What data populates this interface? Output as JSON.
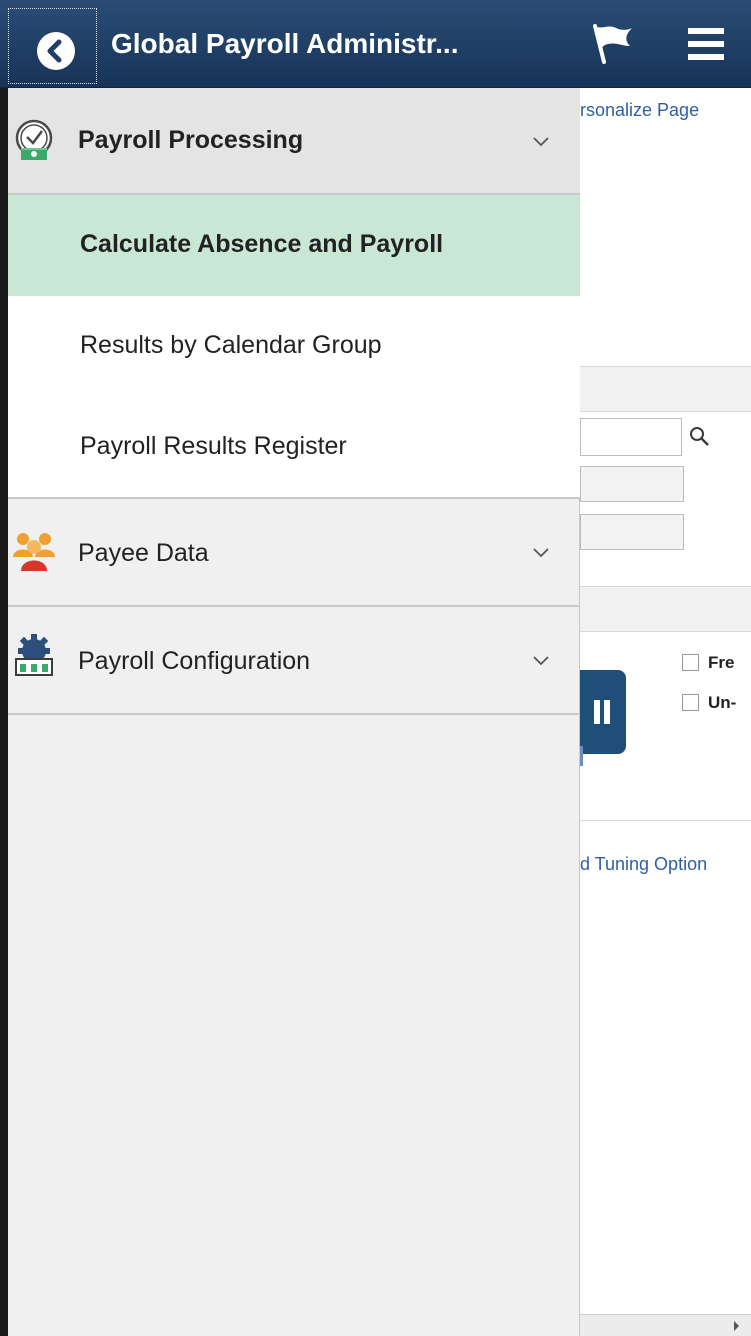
{
  "header": {
    "title": "Global Payroll Administr...",
    "back_icon": "chevron-left-icon",
    "flag_icon": "flag-icon",
    "menu_icon": "hamburger-menu-icon",
    "background_color": "#1f3f66"
  },
  "navigation": {
    "sections": [
      {
        "label": "Payroll Processing",
        "icon": "payroll-processing-icon",
        "expanded": true,
        "items": [
          {
            "label": "Calculate Absence and Payroll",
            "selected": true
          },
          {
            "label": "Results by Calendar Group",
            "selected": false
          },
          {
            "label": "Payroll Results Register",
            "selected": false
          }
        ]
      },
      {
        "label": "Payee Data",
        "icon": "payee-people-icon",
        "expanded": false
      },
      {
        "label": "Payroll Configuration",
        "icon": "payroll-config-gear-icon",
        "expanded": false
      }
    ],
    "selected_color": "#c8e7d4"
  },
  "background_page": {
    "personalize_link": "rsonalize Page",
    "checkbox_1_label": "Fre",
    "checkbox_2_label": "Un-",
    "tuning_link": "d Tuning Option"
  }
}
